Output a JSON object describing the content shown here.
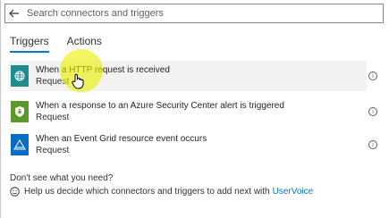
{
  "search": {
    "placeholder": "Search connectors and triggers"
  },
  "tabs": [
    {
      "label": "Triggers",
      "active": true
    },
    {
      "label": "Actions",
      "active": false
    }
  ],
  "items": [
    {
      "title": "When a HTTP request is received",
      "subtitle": "Request",
      "icon": "globe-icon",
      "color": "#1e8c8c"
    },
    {
      "title": "When a response to an Azure Security Center alert is triggered",
      "subtitle": "Request",
      "icon": "shield-icon",
      "color": "#5a9a2c"
    },
    {
      "title": "When an Event Grid resource event occurs",
      "subtitle": "Request",
      "icon": "event-grid-icon",
      "color": "#0a6cc2"
    }
  ],
  "help": {
    "question": "Don't see what you need?",
    "text": "Help us decide which connectors and triggers to add next with",
    "link": "UserVoice"
  },
  "info_glyph": "i",
  "accent": "#0078d4",
  "highlight_color": "#e8f000"
}
